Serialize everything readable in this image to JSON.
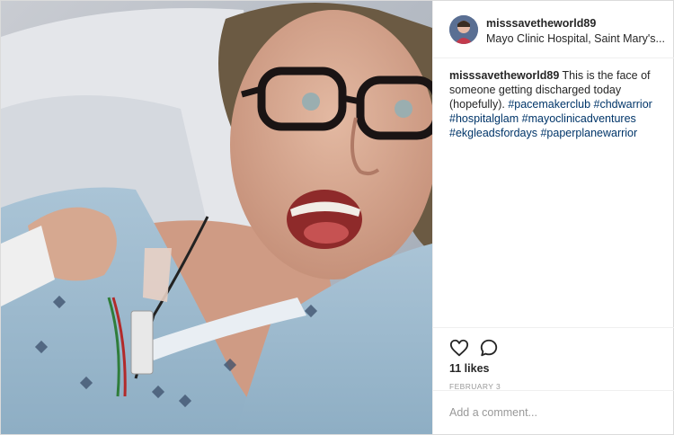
{
  "post": {
    "username": "misssavetheworld89",
    "location": "Mayo Clinic Hospital, Saint Mary's...",
    "caption": {
      "username": "misssavetheworld89",
      "text": " This is the face of someone getting discharged today (hopefully). ",
      "hashtags": [
        "#pacemakerclub",
        "#chdwarrior",
        "#hospitalglam",
        "#mayoclinicadventures",
        "#ekgleadsfordays",
        "#paperplanewarrior"
      ]
    },
    "likes": "11 likes",
    "date": "FEBRUARY 3",
    "comment_placeholder": "Add a comment..."
  },
  "icons": {
    "like": "heart-icon",
    "comment": "comment-bubble-icon"
  },
  "colors": {
    "text": "#262626",
    "hashtag": "#003569",
    "muted": "#999999",
    "border": "#efefef"
  }
}
